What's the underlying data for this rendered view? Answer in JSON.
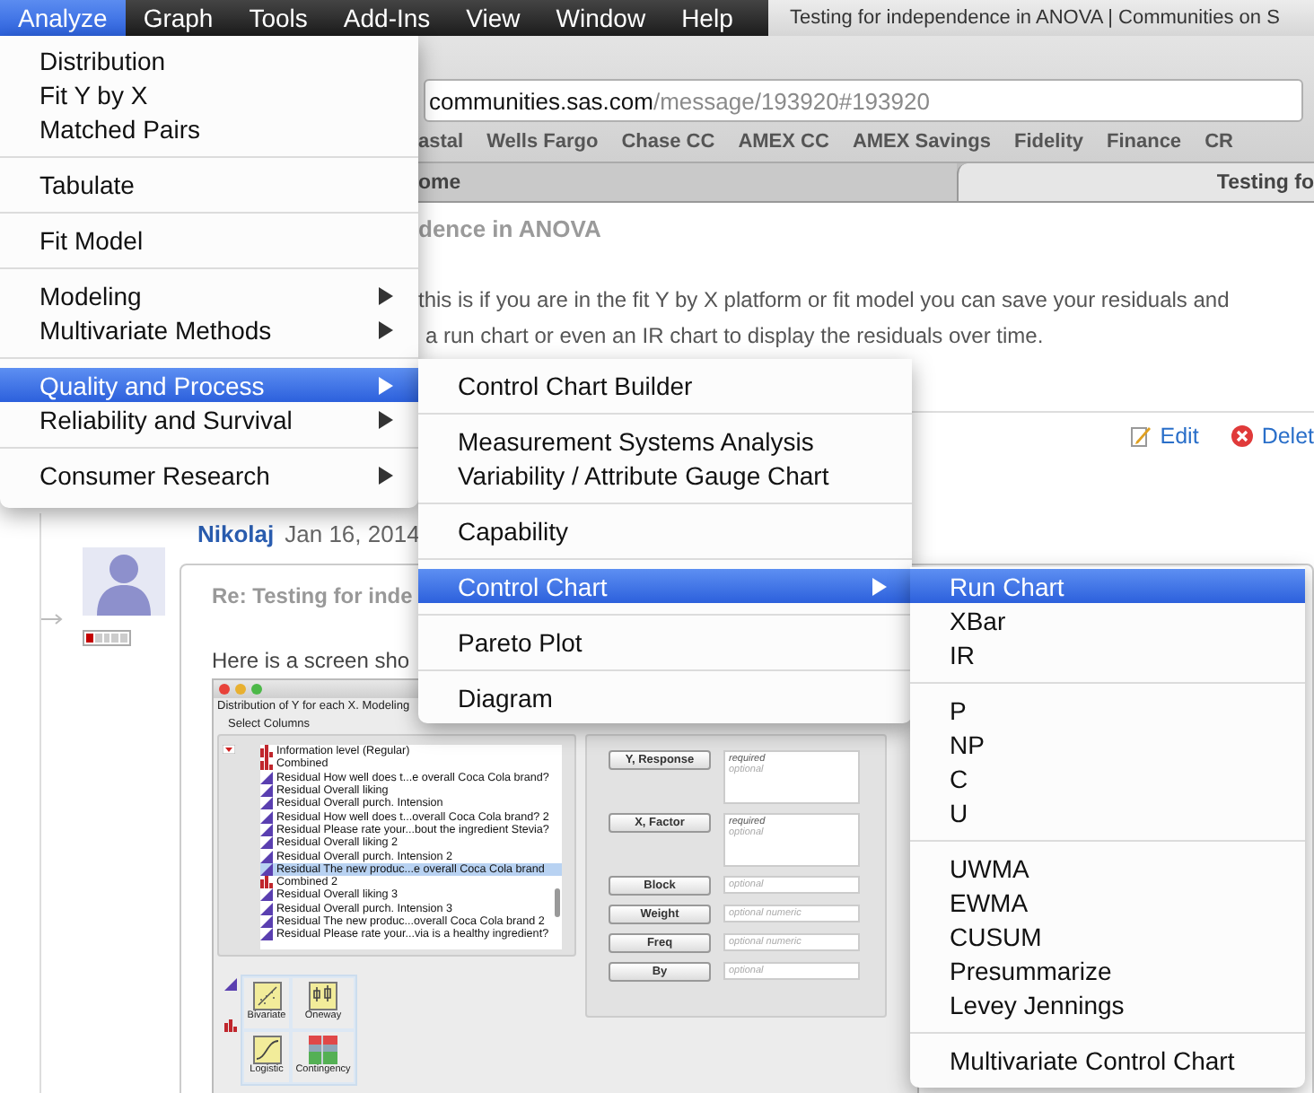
{
  "menu_bar": {
    "items": [
      {
        "label": "Analyze",
        "selected": true
      },
      {
        "label": "Graph",
        "selected": false
      },
      {
        "label": "Tools",
        "selected": false
      },
      {
        "label": "Add-Ins",
        "selected": false
      },
      {
        "label": "View",
        "selected": false
      },
      {
        "label": "Window",
        "selected": false
      },
      {
        "label": "Help",
        "selected": false
      }
    ]
  },
  "browser": {
    "title": "Testing for independence in ANOVA | Communities on S",
    "address": {
      "host": "communities.sas.com",
      "path": "/message/193920#193920"
    },
    "bookmarks": [
      "astal",
      "Wells Fargo",
      "Chase CC",
      "AMEX CC",
      "AMEX Savings",
      "Fidelity",
      "Finance",
      "CR"
    ],
    "tabs": [
      {
        "label": "ome",
        "selected": false
      },
      {
        "label": "Testing fo",
        "selected": true
      }
    ]
  },
  "post": {
    "title": "dence in ANOVA",
    "body": [
      "this is if you are in the fit Y by X platform or fit model you can save your residuals and",
      "a run chart or even an IR chart to display the residuals over time."
    ],
    "actions": [
      {
        "kind": "edit",
        "label": "Edit"
      },
      {
        "kind": "delete",
        "label": "Delet"
      }
    ]
  },
  "reply": {
    "author": "Nikolaj",
    "date": "Jan 16, 2014",
    "rank": {
      "level": 0.2
    },
    "subject": "Re: Testing for inde",
    "body": "Here is a screen sho",
    "screenshot": {
      "header": "Distribution of Y for each X. Modeling",
      "section": "Select Columns",
      "columns": [
        {
          "label": "Information level (Regular)",
          "kind": "nominal",
          "selected": false
        },
        {
          "label": "Combined",
          "kind": "nominal",
          "selected": false
        },
        {
          "label": "Residual How well does t...e overall Coca Cola brand?",
          "kind": "continuous",
          "selected": false
        },
        {
          "label": "Residual Overall liking",
          "kind": "continuous",
          "selected": false
        },
        {
          "label": "Residual Overall purch. Intension",
          "kind": "continuous",
          "selected": false
        },
        {
          "label": "Residual How well does t...overall Coca Cola brand? 2",
          "kind": "continuous",
          "selected": false
        },
        {
          "label": "Residual Please rate your...bout the ingredient Stevia?",
          "kind": "continuous",
          "selected": false
        },
        {
          "label": "Residual Overall liking 2",
          "kind": "continuous",
          "selected": false
        },
        {
          "label": "Residual Overall purch. Intension 2",
          "kind": "continuous",
          "selected": false
        },
        {
          "label": "Residual The new produc...e overall Coca Cola brand",
          "kind": "continuous",
          "selected": true
        },
        {
          "label": "Combined 2",
          "kind": "nominal",
          "selected": false
        },
        {
          "label": "Residual Overall liking 3",
          "kind": "continuous",
          "selected": false
        },
        {
          "label": "Residual Overall purch. Intension 3",
          "kind": "continuous",
          "selected": false
        },
        {
          "label": "Residual The new produc...overall Coca Cola brand 2",
          "kind": "continuous",
          "selected": false
        },
        {
          "label": "Residual Please rate your...via is a healthy ingredient?",
          "kind": "continuous",
          "selected": false
        }
      ],
      "roles": [
        {
          "label": "Y, Response",
          "hints": [
            "required",
            "optional"
          ]
        },
        {
          "label": "X, Factor",
          "hints": [
            "required",
            "optional"
          ]
        },
        {
          "label": "Block",
          "hints": [
            "optional"
          ]
        },
        {
          "label": "Weight",
          "hints": [
            "optional numeric"
          ]
        },
        {
          "label": "Freq",
          "hints": [
            "optional numeric"
          ]
        },
        {
          "label": "By",
          "hints": [
            "optional"
          ]
        }
      ],
      "platforms": [
        {
          "kind": "bivariate",
          "label": "Bivariate"
        },
        {
          "kind": "oneway",
          "label": "Oneway"
        },
        {
          "kind": "logistic",
          "label": "Logistic"
        },
        {
          "kind": "contingency",
          "label": "Contingency"
        }
      ]
    }
  },
  "menus": [
    {
      "groups": [
        [
          {
            "label": "Distribution",
            "submenu": false,
            "selected": false
          },
          {
            "label": "Fit Y by X",
            "submenu": false,
            "selected": false
          },
          {
            "label": "Matched Pairs",
            "submenu": false,
            "selected": false
          }
        ],
        [
          {
            "label": "Tabulate",
            "submenu": false,
            "selected": false
          }
        ],
        [
          {
            "label": "Fit Model",
            "submenu": false,
            "selected": false
          }
        ],
        [
          {
            "label": "Modeling",
            "submenu": true,
            "selected": false
          },
          {
            "label": "Multivariate Methods",
            "submenu": true,
            "selected": false
          }
        ],
        [
          {
            "label": "Quality and Process",
            "submenu": true,
            "selected": true
          },
          {
            "label": "Reliability and Survival",
            "submenu": true,
            "selected": false
          }
        ],
        [
          {
            "label": "Consumer Research",
            "submenu": true,
            "selected": false
          }
        ]
      ]
    },
    {
      "groups": [
        [
          {
            "label": "Control Chart Builder",
            "submenu": false,
            "selected": false
          }
        ],
        [
          {
            "label": "Measurement Systems Analysis",
            "submenu": false,
            "selected": false
          },
          {
            "label": "Variability / Attribute Gauge Chart",
            "submenu": false,
            "selected": false
          }
        ],
        [
          {
            "label": "Capability",
            "submenu": false,
            "selected": false
          }
        ],
        [
          {
            "label": "Control Chart",
            "submenu": true,
            "selected": true
          }
        ],
        [
          {
            "label": "Pareto Plot",
            "submenu": false,
            "selected": false
          }
        ],
        [
          {
            "label": "Diagram",
            "submenu": false,
            "selected": false
          }
        ]
      ]
    },
    {
      "groups": [
        [
          {
            "label": "Run Chart",
            "submenu": false,
            "selected": true
          },
          {
            "label": "XBar",
            "submenu": false,
            "selected": false
          },
          {
            "label": "IR",
            "submenu": false,
            "selected": false
          }
        ],
        [
          {
            "label": "P",
            "submenu": false,
            "selected": false
          },
          {
            "label": "NP",
            "submenu": false,
            "selected": false
          },
          {
            "label": "C",
            "submenu": false,
            "selected": false
          },
          {
            "label": "U",
            "submenu": false,
            "selected": false
          }
        ],
        [
          {
            "label": "UWMA",
            "submenu": false,
            "selected": false
          },
          {
            "label": "EWMA",
            "submenu": false,
            "selected": false
          },
          {
            "label": "CUSUM",
            "submenu": false,
            "selected": false
          },
          {
            "label": "Presummarize",
            "submenu": false,
            "selected": false
          },
          {
            "label": "Levey Jennings",
            "submenu": false,
            "selected": false
          }
        ],
        [
          {
            "label": "Multivariate Control Chart",
            "submenu": false,
            "selected": false
          }
        ]
      ]
    }
  ]
}
